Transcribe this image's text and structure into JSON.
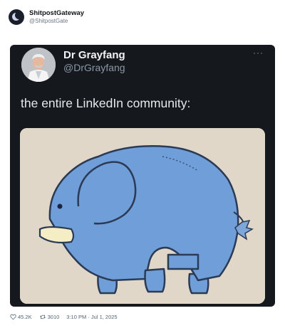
{
  "outer": {
    "name": "ShitpostGateway",
    "handle": "@ShitpostGate"
  },
  "inner": {
    "name": "Dr Grayfang",
    "handle": "@DrGrayfang",
    "text": "the entire LinkedIn community:",
    "more": "···"
  },
  "footer": {
    "likes": "45.2K",
    "retweets": "3010",
    "timestamp": "3:10 PM · Jul 1, 2025"
  },
  "colors": {
    "card_bg": "#15181d",
    "elephant": "#6f9ed8",
    "media_bg": "#dcd3c3"
  },
  "icons": {
    "like": "heart-icon",
    "retweet": "retweet-icon",
    "more": "more-dots-icon"
  }
}
